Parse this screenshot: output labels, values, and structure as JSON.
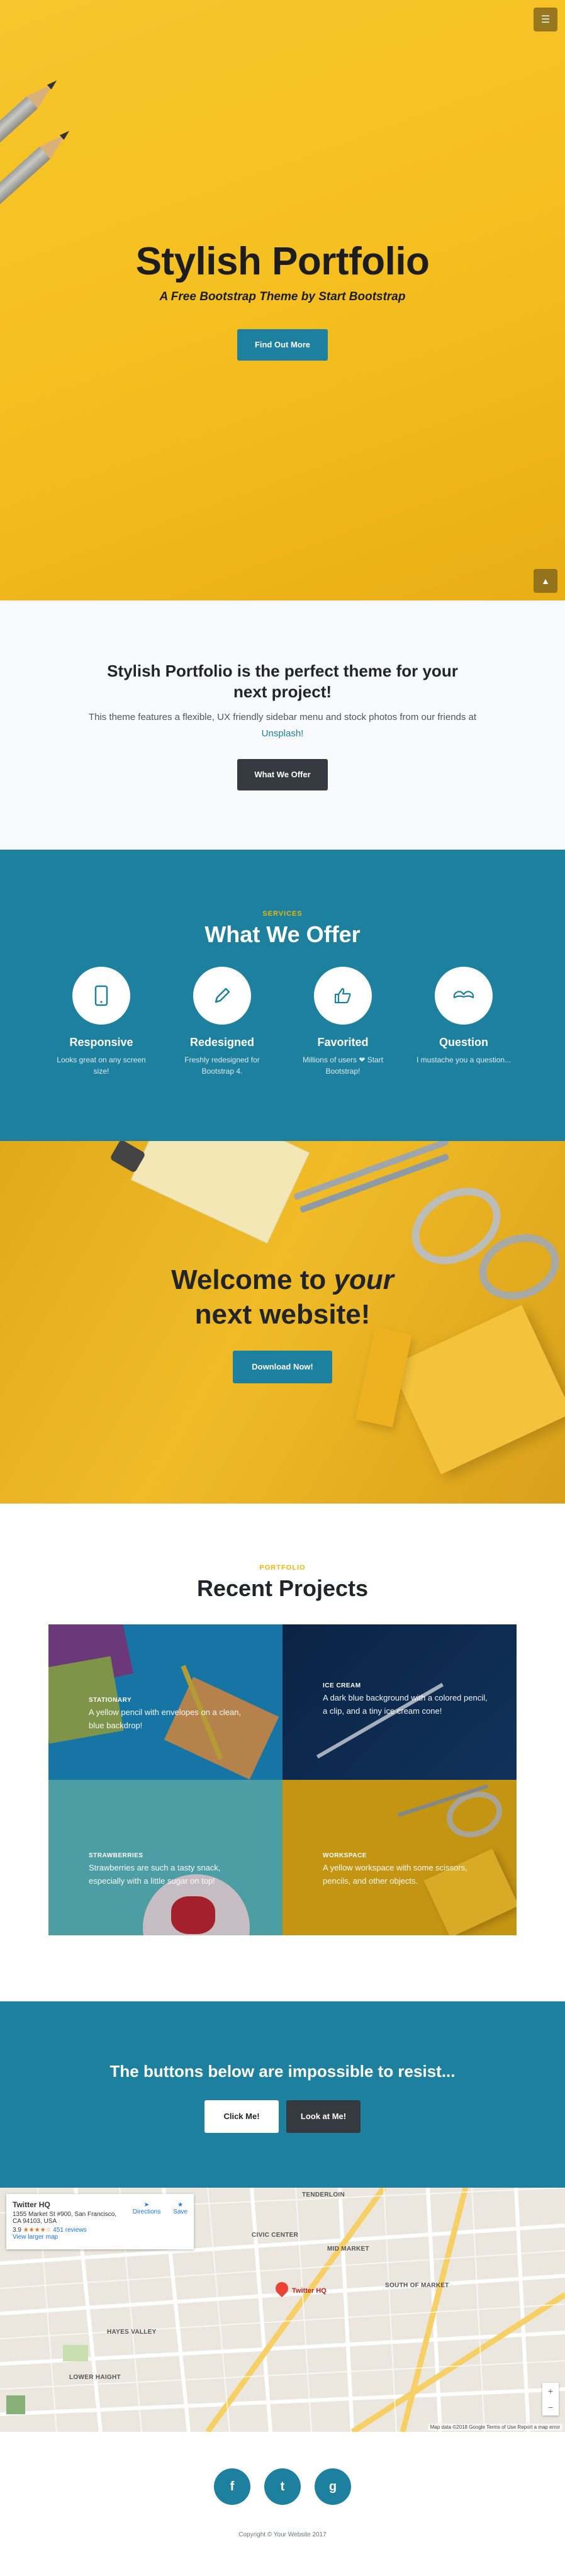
{
  "nav": {
    "menu_icon": "menu-icon",
    "scroll_top_icon": "chevron-up-icon"
  },
  "hero": {
    "title": "Stylish Portfolio",
    "subtitle": "A Free Bootstrap Theme by Start Bootstrap",
    "button": "Find Out More"
  },
  "about": {
    "heading": "Stylish Portfolio is the perfect theme for your next project!",
    "text": "This theme features a flexible, UX friendly sidebar menu and stock photos from our friends at",
    "link": "Unsplash!",
    "button": "What We Offer"
  },
  "services": {
    "kicker": "SERVICES",
    "heading": "What We Offer",
    "items": [
      {
        "icon": "phone-icon",
        "title": "Responsive",
        "text": "Looks great on any screen size!"
      },
      {
        "icon": "pencil-icon",
        "title": "Redesigned",
        "text": "Freshly redesigned for Bootstrap 4."
      },
      {
        "icon": "like-icon",
        "title": "Favorited",
        "text": "Millions of users ❤ Start Bootstrap!"
      },
      {
        "icon": "mustache-icon",
        "title": "Question",
        "text": "I mustache you a question..."
      }
    ]
  },
  "callout": {
    "line1_plain": "Welcome to ",
    "line1_em": "your",
    "line2": "next website!",
    "button": "Download Now!"
  },
  "portfolio": {
    "kicker": "PORTFOLIO",
    "heading": "Recent Projects",
    "items": [
      {
        "title": "STATIONARY",
        "text": "A yellow pencil with envelopes on a clean, blue backdrop!"
      },
      {
        "title": "ICE CREAM",
        "text": "A dark blue background with a colored pencil, a clip, and a tiny ice cream cone!"
      },
      {
        "title": "STRAWBERRIES",
        "text": "Strawberries are such a tasty snack, especially with a little sugar on top!"
      },
      {
        "title": "WORKSPACE",
        "text": "A yellow workspace with some scissors, pencils, and other objects."
      }
    ]
  },
  "cta": {
    "heading": "The buttons below are impossible to resist...",
    "button1": "Click Me!",
    "button2": "Look at Me!"
  },
  "map": {
    "place": "Twitter HQ",
    "address": "1355 Market St #900, San Francisco, CA 94103, USA",
    "rating": "3.9",
    "stars": "★★★★☆",
    "reviews": "451 reviews",
    "larger_map": "View larger map",
    "directions": "Directions",
    "save": "Save",
    "pin_label": "Twitter HQ",
    "attribution": "Map data ©2018 Google   Terms of Use   Report a map error",
    "labels": [
      "TENDERLOIN",
      "CIVIC CENTER",
      "MID MARKET",
      "SOUTH OF MARKET",
      "HAYES VALLEY",
      "LOWER HAIGHT"
    ]
  },
  "footer": {
    "social_icons": [
      "facebook-icon",
      "twitter-icon",
      "github-icon"
    ],
    "social_glyphs": [
      "f",
      "t",
      "g"
    ],
    "copyright": "Copyright © Your Website 2017"
  },
  "colors": {
    "primary": "#1d809f",
    "accent": "#ecb807",
    "dark": "#343a40",
    "hero_yellow": "#f5bf20"
  }
}
